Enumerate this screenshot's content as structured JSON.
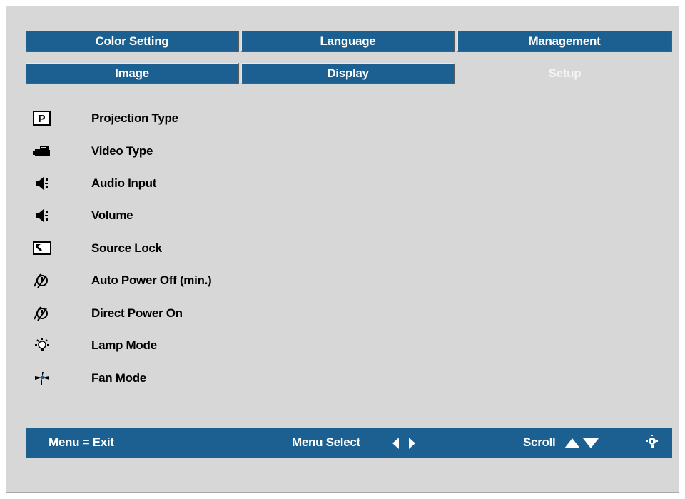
{
  "tabs_row1": [
    {
      "label": "Color Setting"
    },
    {
      "label": "Language"
    },
    {
      "label": "Management"
    }
  ],
  "tabs_row2": [
    {
      "label": "Image"
    },
    {
      "label": "Display"
    },
    {
      "label": "Setup",
      "active": true
    }
  ],
  "menu_items": [
    {
      "label": "Projection Type",
      "icon": "projection-type-icon"
    },
    {
      "label": "Video Type",
      "icon": "camcorder-icon"
    },
    {
      "label": "Audio Input",
      "icon": "speaker-icon"
    },
    {
      "label": "Volume",
      "icon": "speaker-icon"
    },
    {
      "label": "Source Lock",
      "icon": "source-lock-icon"
    },
    {
      "label": "Auto Power Off (min.)",
      "icon": "power-timer-icon"
    },
    {
      "label": "Direct Power On",
      "icon": "power-timer-icon"
    },
    {
      "label": "Lamp Mode",
      "icon": "lamp-icon"
    },
    {
      "label": "Fan Mode",
      "icon": "fan-icon"
    }
  ],
  "footer": {
    "exit_label": "Menu = Exit",
    "select_label": "Menu Select",
    "scroll_label": "Scroll"
  },
  "colors": {
    "accent": "#1c5f91",
    "panel": "#d7d7d7"
  }
}
